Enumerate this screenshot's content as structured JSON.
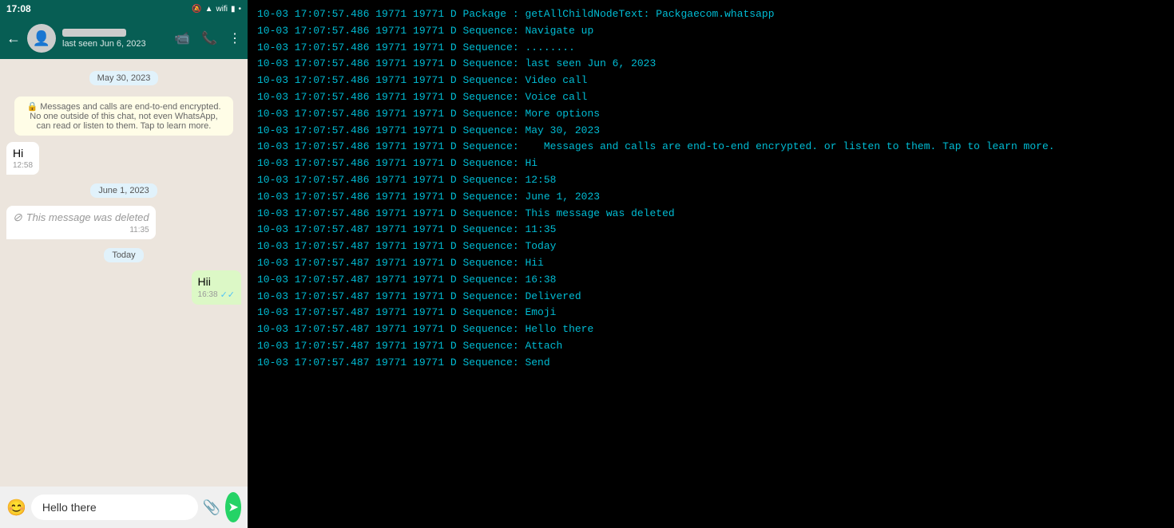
{
  "status_bar": {
    "time": "17:08",
    "signal_icon": "●●●",
    "wifi_icon": "wifi",
    "battery_icon": "▮"
  },
  "header": {
    "contact_name": "",
    "contact_status": "last seen Jun 6, 2023",
    "video_icon": "📹",
    "call_icon": "📞",
    "more_icon": "⋮",
    "back_icon": "←"
  },
  "messages": [
    {
      "type": "date",
      "label": "May 30, 2023"
    },
    {
      "type": "system",
      "text": "🔒 Messages and calls are end-to-end encrypted. No one outside of this chat, not even WhatsApp, can read or listen to them. Tap to learn more."
    },
    {
      "type": "received",
      "text": "Hi",
      "time": "12:58"
    },
    {
      "type": "date",
      "label": "June 1, 2023"
    },
    {
      "type": "deleted",
      "time": "11:35"
    },
    {
      "type": "date",
      "label": "Today"
    },
    {
      "type": "sent",
      "text": "Hii",
      "time": "16:38"
    }
  ],
  "input": {
    "placeholder": "Hello there",
    "value": "Hello there",
    "emoji_label": "😊",
    "attach_label": "📎",
    "send_label": "➤"
  },
  "log_lines": [
    "10-03 17:07:57.486 19771 19771 D Package : getAllChildNodeText: Packgaecom.whatsapp",
    "10-03 17:07:57.486 19771 19771 D Sequence: Navigate up",
    "10-03 17:07:57.486 19771 19771 D Sequence: ........",
    "10-03 17:07:57.486 19771 19771 D Sequence: last seen Jun 6, 2023",
    "10-03 17:07:57.486 19771 19771 D Sequence: Video call",
    "10-03 17:07:57.486 19771 19771 D Sequence: Voice call",
    "10-03 17:07:57.486 19771 19771 D Sequence: More options",
    "10-03 17:07:57.486 19771 19771 D Sequence: May 30, 2023",
    "10-03 17:07:57.486 19771 19771 D Sequence:    Messages and calls are end-to-end encrypted. or listen to them. Tap to learn more.",
    "10-03 17:07:57.486 19771 19771 D Sequence: Hi",
    "10-03 17:07:57.486 19771 19771 D Sequence: 12:58",
    "10-03 17:07:57.486 19771 19771 D Sequence: June 1, 2023",
    "10-03 17:07:57.486 19771 19771 D Sequence: This message was deleted",
    "10-03 17:07:57.487 19771 19771 D Sequence: 11:35",
    "10-03 17:07:57.487 19771 19771 D Sequence: Today",
    "10-03 17:07:57.487 19771 19771 D Sequence: Hii",
    "10-03 17:07:57.487 19771 19771 D Sequence: 16:38",
    "10-03 17:07:57.487 19771 19771 D Sequence: Delivered",
    "10-03 17:07:57.487 19771 19771 D Sequence: Emoji",
    "10-03 17:07:57.487 19771 19771 D Sequence: Hello there",
    "10-03 17:07:57.487 19771 19771 D Sequence: Attach",
    "10-03 17:07:57.487 19771 19771 D Sequence: Send"
  ]
}
